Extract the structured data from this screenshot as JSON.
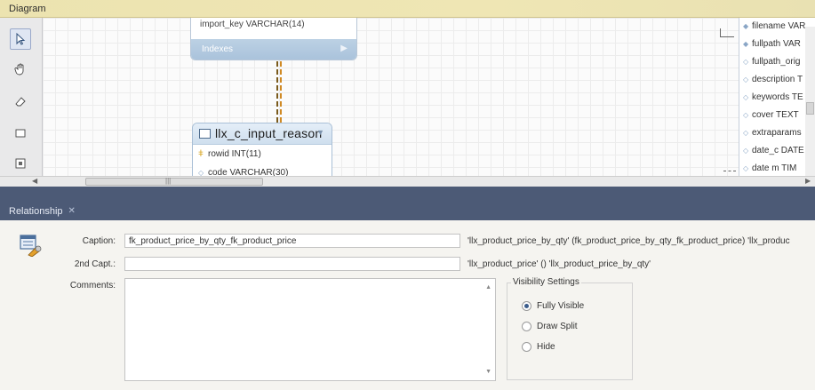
{
  "diagram": {
    "title": "Diagram",
    "entity_top": {
      "partial_row": "import_key VARCHAR(14)",
      "indexes_label": "Indexes"
    },
    "entity": {
      "name": "llx_c_input_reason",
      "columns": [
        {
          "text": "rowid INT(11)",
          "icon": "key-icon"
        },
        {
          "text": "code VARCHAR(30)",
          "icon": "diamond-icon"
        }
      ]
    },
    "right_entity_columns": [
      "filename VAR",
      "fullpath VAR",
      "fullpath_orig",
      "description T",
      "keywords TE",
      "cover TEXT",
      "extraparams",
      "date_c DATE",
      "date m TIM"
    ]
  },
  "relationship_tab": {
    "label": "Relationship"
  },
  "form": {
    "caption_label": "Caption:",
    "caption_value": "fk_product_price_by_qty_fk_product_price",
    "caption_desc": "'llx_product_price_by_qty' (fk_product_price_by_qty_fk_product_price) 'llx_produc",
    "second_caption_label": "2nd Capt.:",
    "second_caption_value": "",
    "second_caption_desc": "'llx_product_price' () 'llx_product_price_by_qty'",
    "comments_label": "Comments:",
    "comments_value": ""
  },
  "visibility": {
    "legend": "Visibility Settings",
    "options": [
      {
        "label": "Fully Visible",
        "selected": true
      },
      {
        "label": "Draw Split",
        "selected": false
      },
      {
        "label": "Hide",
        "selected": false
      }
    ]
  }
}
